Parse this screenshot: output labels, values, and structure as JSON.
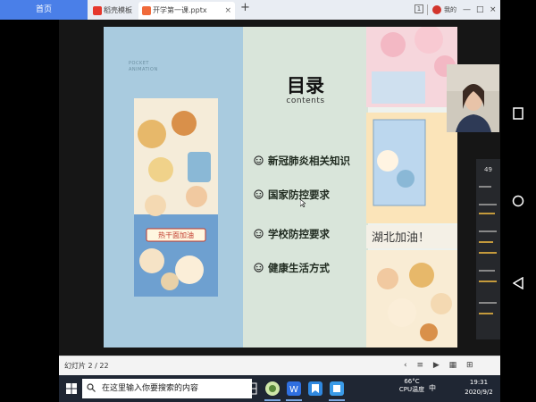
{
  "browser": {
    "home_tab": "首页",
    "tabs": [
      {
        "label": "稻壳模板",
        "icon": "docer-icon"
      },
      {
        "label": "开学第一课.pptx",
        "icon": "ppt-icon"
      }
    ],
    "tab_close": "×",
    "new_tab": "+",
    "page_counter": "1",
    "login_label": "我的",
    "minimize": "—",
    "maximize": "□",
    "close": "×"
  },
  "slide": {
    "pocket_text": "POCKET\nANIMATION",
    "title": "目录",
    "subtitle": "contents",
    "items": [
      {
        "label": "新冠肺炎相关知识"
      },
      {
        "label": "国家防控要求"
      },
      {
        "label": "学校防控要求"
      },
      {
        "label": "健康生活方式"
      }
    ],
    "banner_left": "热干面加油",
    "banner_right": "湖北加油！"
  },
  "chat": {
    "count": "49"
  },
  "statusbar": {
    "slide_indicator": "幻灯片 2 / 22",
    "view_icons": "‹ ≡ ▶ ▦ ⊞"
  },
  "taskbar": {
    "search_placeholder": "在这里输入你要搜索的内容",
    "temperature": "66°C",
    "temperature_label": "CPU温度",
    "ime": "中",
    "time": "19:31",
    "date": "2020/9/2"
  },
  "colors": {
    "home_tab": "#4a7fe8",
    "slide_left": "#a9cbdf",
    "slide_mid": "#d9e5da",
    "taskbar": "#1f2633"
  }
}
